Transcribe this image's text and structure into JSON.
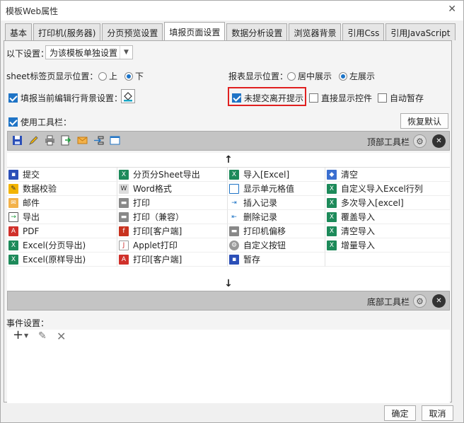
{
  "window": {
    "title": "模板Web属性",
    "close": "✕"
  },
  "tabs": [
    {
      "label": "基本"
    },
    {
      "label": "打印机(服务器)"
    },
    {
      "label": "分页预览设置"
    },
    {
      "label": "填报页面设置"
    },
    {
      "label": "数据分析设置"
    },
    {
      "label": "浏览器背景"
    },
    {
      "label": "引用Css"
    },
    {
      "label": "引用JavaScript"
    }
  ],
  "settings": {
    "following_label": "以下设置：",
    "following_value": "为该模板单独设置",
    "sheet_pos_label": "sheet标签页显示位置：",
    "sheet_pos_options": [
      "上",
      "下"
    ],
    "sheet_pos_selected": "下",
    "report_pos_label": "报表显示位置：",
    "report_pos_options": [
      "居中展示",
      "左展示"
    ],
    "report_pos_selected": "左展示",
    "fill_bg_label": "填报当前编辑行背景设置：",
    "unsubmitted_label": "未提交离开提示",
    "direct_show_label": "直接显示控件",
    "auto_save_label": "自动暂存",
    "use_toolbar_label": "使用工具栏：",
    "restore_default": "恢复默认"
  },
  "top_toolbar": {
    "label": "顶部工具栏"
  },
  "bottom_toolbar": {
    "label": "底部工具栏"
  },
  "button_grid": [
    [
      "提交",
      "分页分Sheet导出",
      "导入[Excel]",
      "清空"
    ],
    [
      "数据校验",
      "Word格式",
      "显示单元格值",
      "自定义导入Excel行列"
    ],
    [
      "邮件",
      "打印",
      "插入记录",
      "多次导入[excel]"
    ],
    [
      "导出",
      "打印（兼容）",
      "删除记录",
      "覆盖导入"
    ],
    [
      "PDF",
      "打印[客户端]",
      "打印机偏移",
      "清空导入"
    ],
    [
      "Excel(分页导出)",
      "Applet打印",
      "自定义按钮",
      "增量导入"
    ],
    [
      "Excel(原样导出)",
      "打印[客户端]",
      "暂存",
      ""
    ]
  ],
  "event_settings": {
    "label": "事件设置："
  },
  "footer": {
    "ok": "确定",
    "cancel": "取消"
  },
  "colors": {
    "accent": "#1f74c6",
    "highlight_border": "#e02020",
    "toolbar_bg": "#c4c4c4"
  }
}
